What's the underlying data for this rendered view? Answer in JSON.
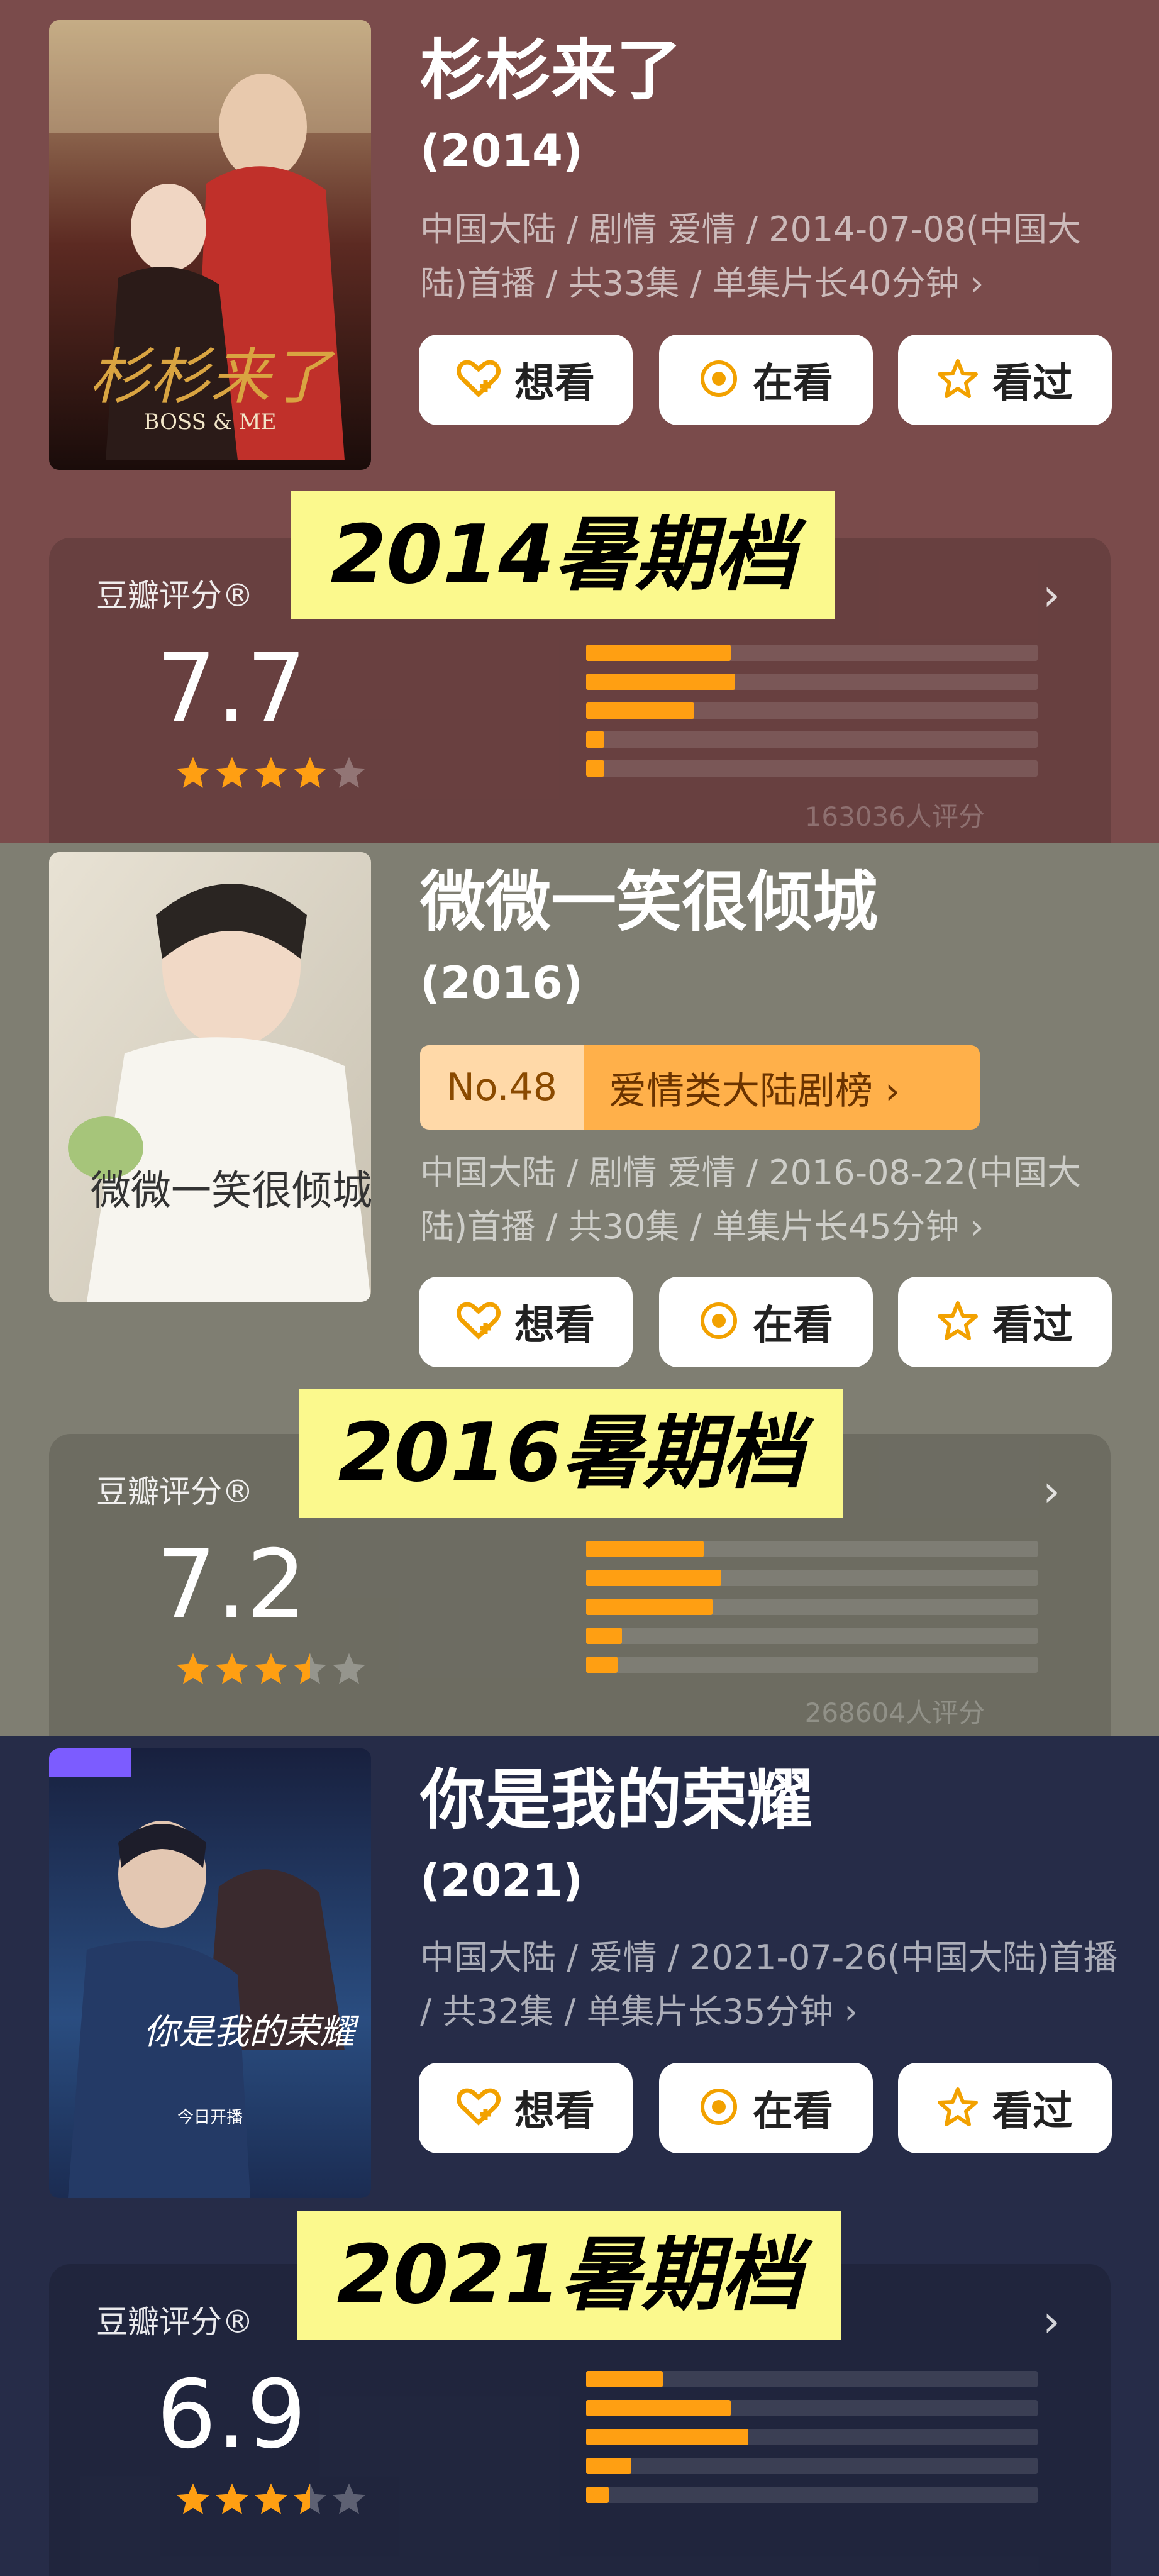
{
  "items": [
    {
      "title": "杉杉来了",
      "year": "(2014)",
      "meta": "中国大陆 / 剧情 爱情 / 2014-07-08(中国大陆)首播 / 共33集 / 单集片长40分钟 ›",
      "poster_text": "杉杉来了",
      "poster_subtitle": "BOSS & ME",
      "buttons": {
        "want": "想看",
        "watching": "在看",
        "watched": "看过"
      },
      "rating_label": "豆瓣评分®",
      "score": "7.7",
      "stars": 4,
      "distribution": [
        0.32,
        0.33,
        0.24,
        0.04,
        0.04
      ],
      "count": "163036人评分",
      "banner": "2014暑期档",
      "bg": "#7a4b4b"
    },
    {
      "title": "微微一笑很倾城",
      "year": "(2016)",
      "rank_no": "No.48",
      "rank_cat": "爱情类大陆剧榜  ›",
      "meta": "中国大陆 / 剧情 爱情 / 2016-08-22(中国大陆)首播 / 共30集 / 单集片长45分钟 ›",
      "poster_text": "微微一笑很倾城",
      "buttons": {
        "want": "想看",
        "watching": "在看",
        "watched": "看过"
      },
      "rating_label": "豆瓣评分®",
      "score": "7.2",
      "stars": 3.5,
      "distribution": [
        0.26,
        0.3,
        0.28,
        0.08,
        0.07
      ],
      "count": "268604人评分",
      "banner": "2016暑期档",
      "bg": "#7f7e72"
    },
    {
      "title": "你是我的荣耀",
      "year": "(2021)",
      "meta": "中国大陆 / 爱情 / 2021-07-26(中国大陆)首播 / 共32集 / 单集片长35分钟 ›",
      "poster_text": "你是我的荣耀",
      "poster_sub": "今日开播",
      "buttons": {
        "want": "想看",
        "watching": "在看",
        "watched": "看过"
      },
      "rating_label": "豆瓣评分®",
      "score": "6.9",
      "stars": 3.5,
      "distribution": [
        0.17,
        0.32,
        0.36,
        0.1,
        0.05
      ],
      "count": "",
      "banner": "2021暑期档",
      "bg": "#262c48"
    }
  ],
  "colors": {
    "accent": "#ff9f12",
    "banner_bg": "#fbf98d",
    "button_icon": "#f2a100"
  },
  "icons": {
    "want": "heart-plus-icon",
    "watching": "target-icon",
    "watched": "star-outline-icon"
  }
}
